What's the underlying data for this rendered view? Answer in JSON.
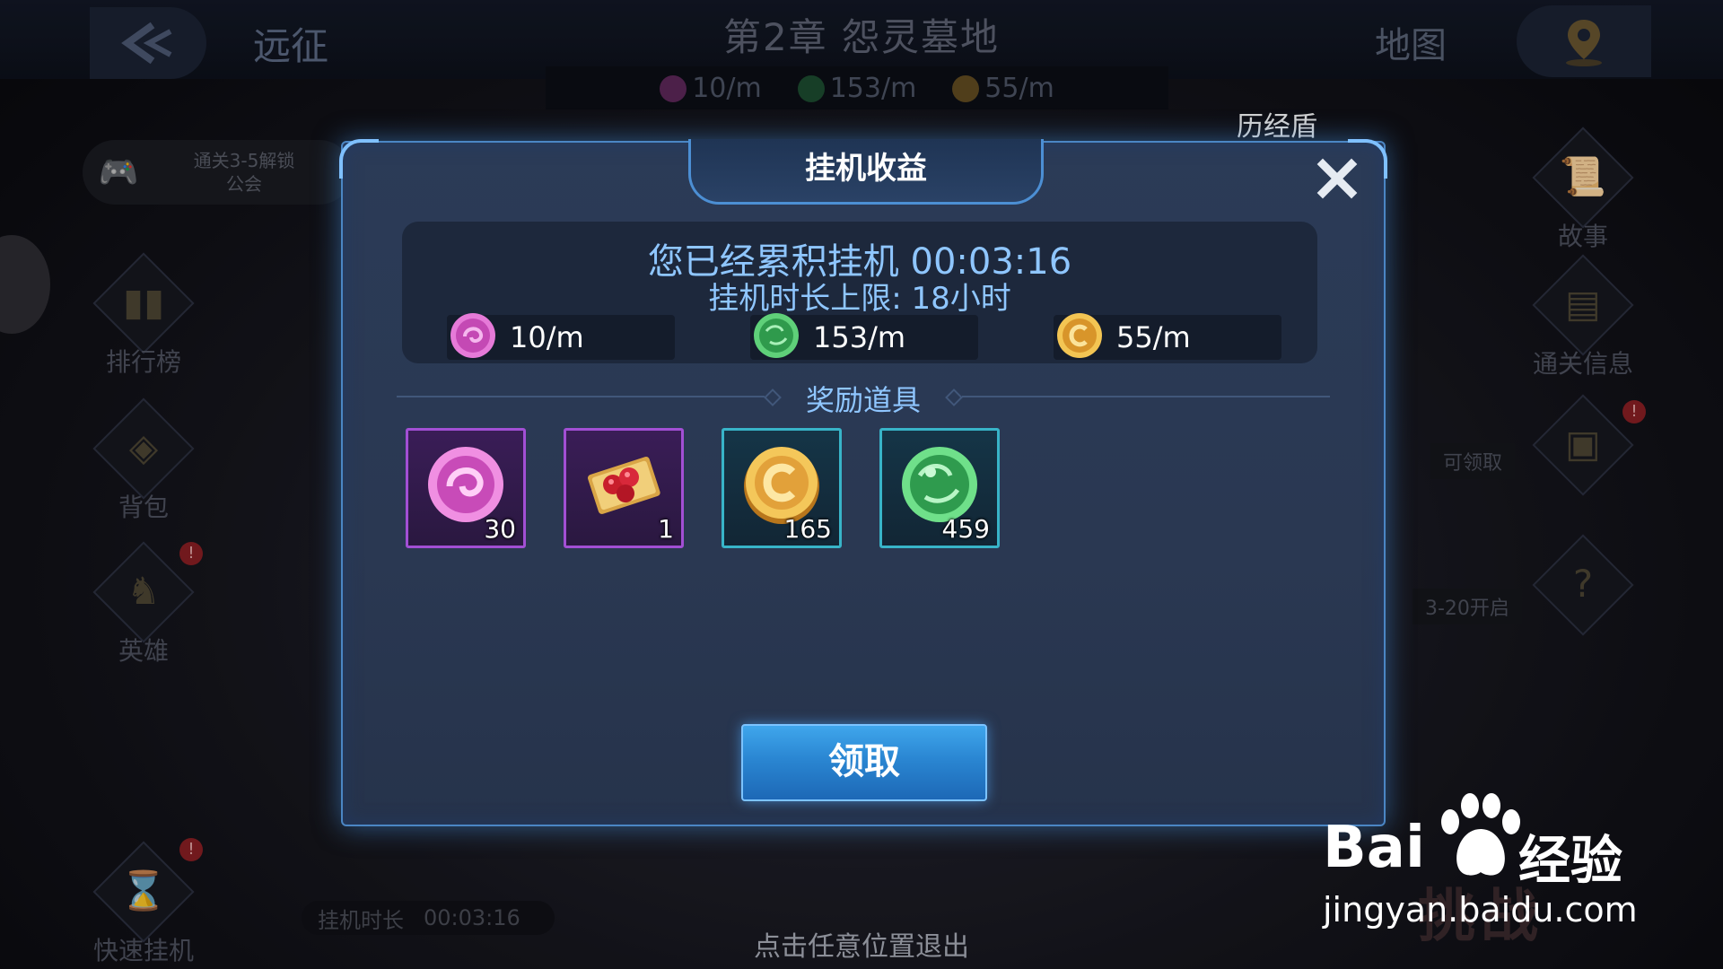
{
  "header": {
    "back_label": "远征",
    "chapter": "第2章  怨灵墓地",
    "map_label": "地图",
    "rates": [
      {
        "color": "#b0429e",
        "text": "10/m"
      },
      {
        "color": "#2f8a4b",
        "text": "153/m"
      },
      {
        "color": "#b9892d",
        "text": "55/m"
      }
    ],
    "history_label": "历经盾"
  },
  "left_menu": {
    "guild_text": "通关3-5解锁\n公会",
    "items": [
      {
        "label": "排行榜"
      },
      {
        "label": "背包"
      },
      {
        "label": "英雄"
      },
      {
        "label": "快速挂机"
      }
    ],
    "bottom_timer_label": "挂机时长",
    "bottom_timer_value": "00:03:16"
  },
  "right_menu": {
    "items": [
      {
        "label": "故事"
      },
      {
        "label": "通关信息"
      }
    ],
    "claimable_tag": "可领取",
    "unlock_tag": "3-20开启",
    "alert_glyph": "!"
  },
  "dialog": {
    "title": "挂机收益",
    "close_glyph": "X",
    "accumulated": "您已经累积挂机  00:03:16",
    "limit": "挂机时长上限: 18小时",
    "rates": [
      {
        "icon": "pink-orb-icon",
        "color": "#d25ac6",
        "text": "10/m"
      },
      {
        "icon": "green-orb-icon",
        "color": "#3bb35a",
        "text": "153/m"
      },
      {
        "icon": "gold-coin-icon",
        "color": "#e4a735",
        "text": "55/m"
      }
    ],
    "reward_title": "奖励道具",
    "rewards": [
      {
        "icon": "pink-orb-icon",
        "qty": "30",
        "frame": "purple"
      },
      {
        "icon": "gem-ticket-icon",
        "qty": "1",
        "frame": "purple"
      },
      {
        "icon": "gold-coin-icon",
        "qty": "165",
        "frame": "teal"
      },
      {
        "icon": "green-orb-icon",
        "qty": "459",
        "frame": "teal"
      }
    ],
    "claim_label": "领取"
  },
  "footer": {
    "exit_hint": "点击任意位置退出",
    "challenge_text": "挑战"
  },
  "watermark": {
    "brand": "Bai",
    "brand_suffix": "经验",
    "url": "jingyan.baidu.com"
  }
}
